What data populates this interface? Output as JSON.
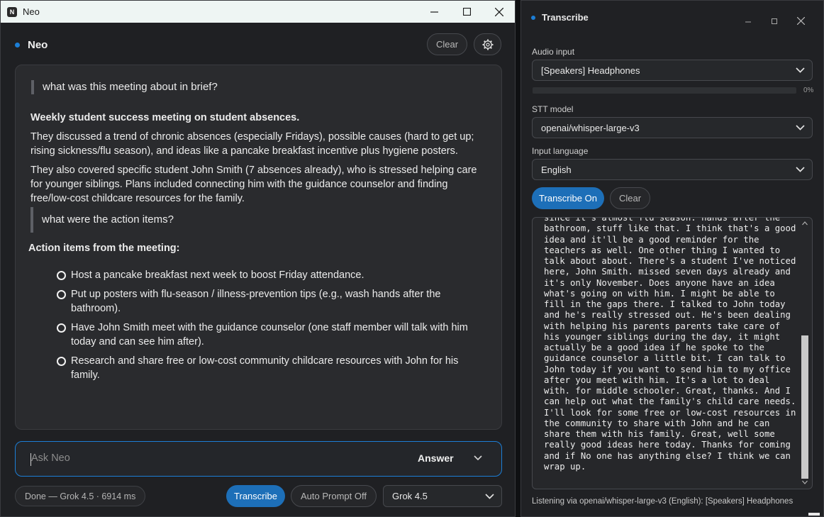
{
  "neo": {
    "window_title": "Neo",
    "title": "Neo",
    "clear_label": "Clear",
    "messages": [
      {
        "question": "what was this meeting about in brief?",
        "answer_title": "Weekly student success meeting on student absences.",
        "answer_p1": "They discussed a trend of chronic absences (especially Fridays), possible causes (hard to get up; rising sickness/flu season), and ideas like a pancake breakfast incentive plus hygiene posters.",
        "answer_p2": "They also covered specific student John Smith (7 absences already), who is stressed helping care for younger siblings. Plans included connecting him with the guidance counselor and finding free/low-cost childcare resources for the family."
      },
      {
        "question": "what were the action items?",
        "answer_title": "Action items from the meeting:",
        "items": [
          "Host a pancake breakfast next week to boost Friday attendance.",
          "Put up posters with flu-season / illness-prevention tips (e.g., wash hands after the bathroom).",
          "Have John Smith meet with the guidance counselor (one staff member will talk with him today and can see him after).",
          "Research and share free or low-cost community childcare resources with John for his family."
        ]
      }
    ],
    "ask_placeholder": "Ask Neo",
    "answer_label": "Answer",
    "status": "Done — Grok 4.5 · 6914 ms",
    "transcribe_label": "Transcribe",
    "auto_prompt_label": "Auto Prompt Off",
    "model_selected": "Grok 4.5"
  },
  "transcribe": {
    "title": "Transcribe",
    "audio_input_label": "Audio input",
    "audio_input_value": "[Speakers] Headphones",
    "level_percent": "0%",
    "level_value": 0,
    "stt_label": "STT model",
    "stt_value": "openai/whisper-large-v3",
    "lang_label": "Input language",
    "lang_value": "English",
    "transcribe_on_label": "Transcribe On",
    "clear_label": "Clear",
    "transcript_lines": [
      "since it's almost flu season. hands after the",
      "bathroom, stuff like that. I think that's a good",
      "idea and it'll be a good reminder for the",
      "teachers as well. One other thing I wanted to",
      "talk about about. There's a student I've noticed",
      "here, John Smith. missed seven days already and",
      "it's only November. Does anyone have an idea",
      "what's going on with him. I might be able to",
      "fill in the gaps there. I talked to John today",
      "and he's really stressed out. He's been dealing",
      "with helping his parents parents take care of",
      "his younger siblings during the day, it might",
      "actually be a good idea if he spoke to the",
      "guidance counselor a little bit. I can talk to",
      "John today if you want to send him to my office",
      "after you meet with him. It's a lot to deal",
      "with. for middle schooler. Great, thanks. And I",
      "can help out what the family's child care needs.",
      "I'll look for some free or low-cost resources in",
      "the community to share with John and he can",
      "share them with his family. Great, well some",
      "really good ideas here today. Thanks for coming",
      "and if No one has anything else? I think we can",
      "wrap up."
    ],
    "footer": "Listening via openai/whisper-large-v3 (English): [Speakers] Headphones"
  },
  "colors": {
    "accent": "#1d6fb8",
    "focus": "#1c7ed6"
  },
  "icons": [
    "app-icon",
    "minimize-icon",
    "maximize-icon",
    "close-icon",
    "gear-icon",
    "chevron-down-icon",
    "status-dot-icon",
    "bullet-circle-icon"
  ]
}
